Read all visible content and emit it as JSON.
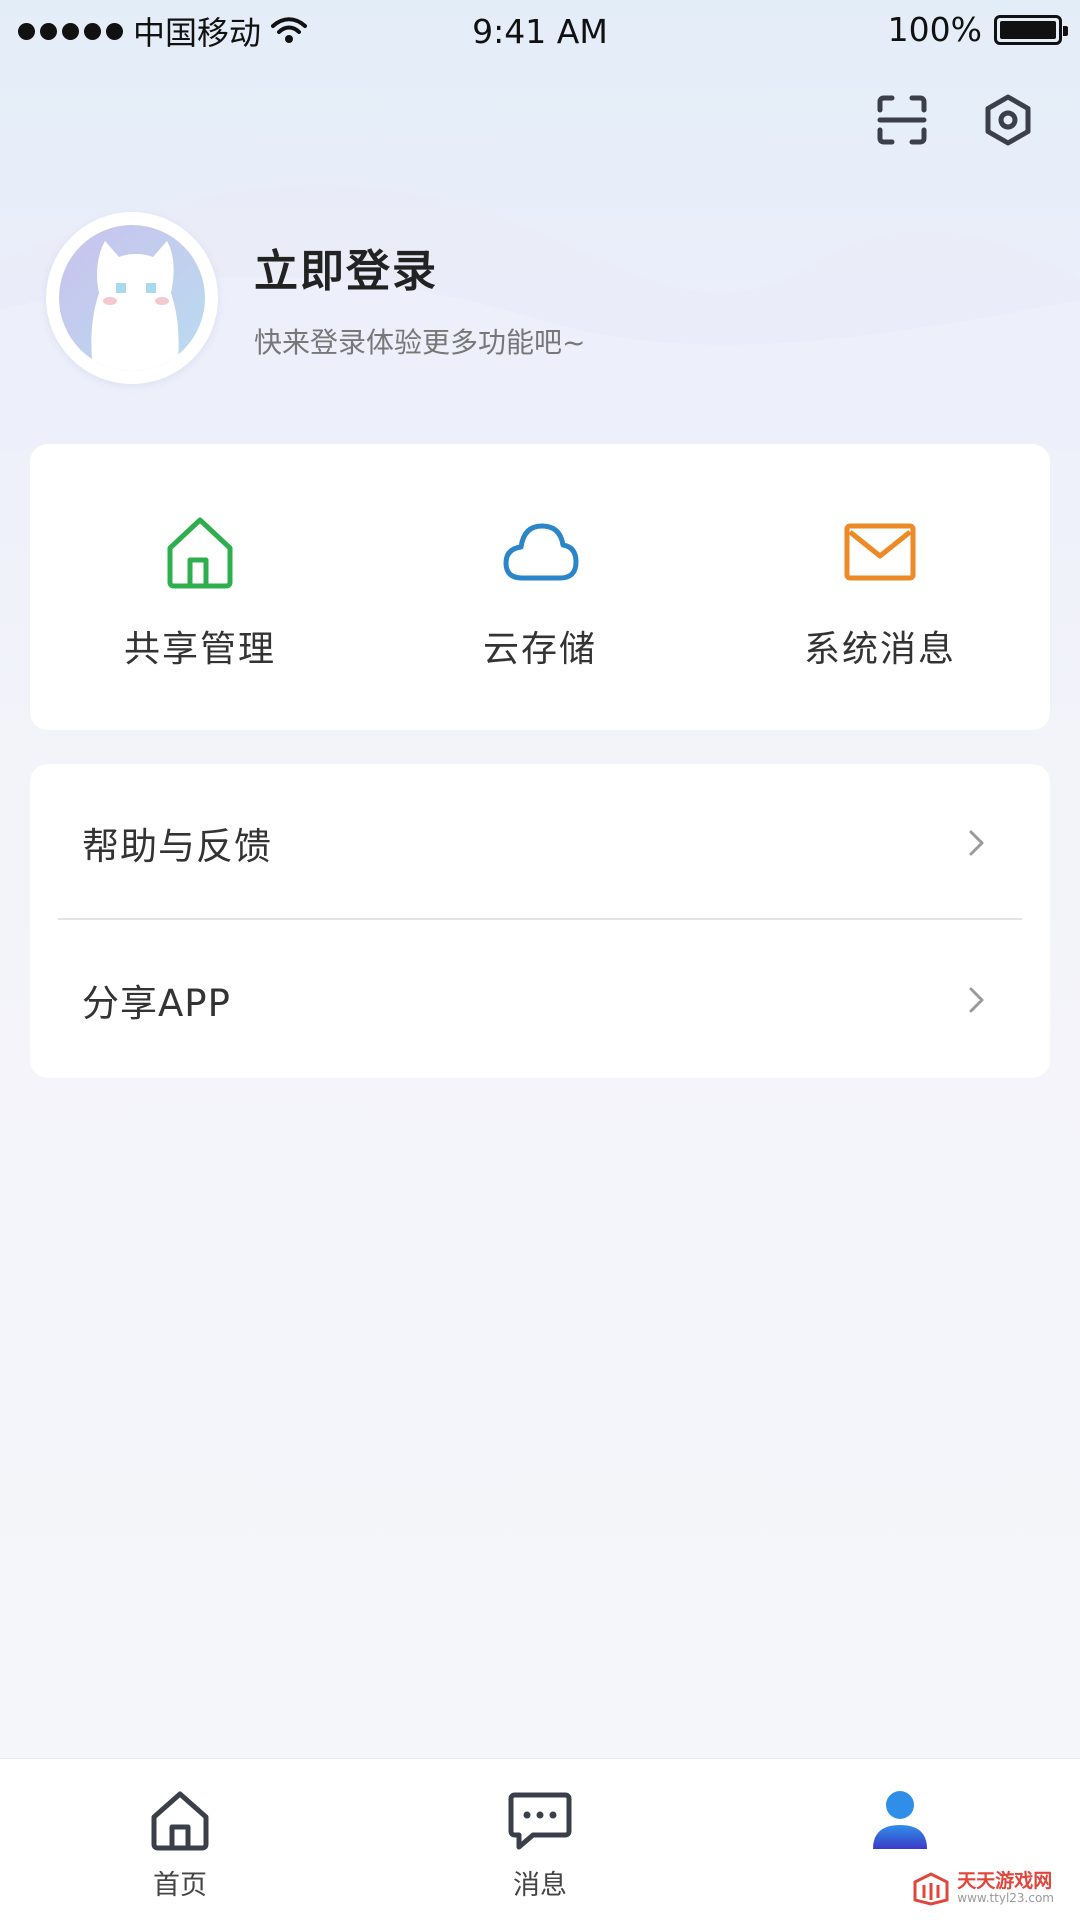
{
  "status_bar": {
    "carrier": "中国移动",
    "time": "9:41 AM",
    "battery": "100%",
    "battery_level": 1.0
  },
  "header": {
    "scan_icon": "scan-icon",
    "settings_icon": "gear-icon"
  },
  "profile": {
    "title": "立即登录",
    "subtitle": "快来登录体验更多功能吧~"
  },
  "features": [
    {
      "label": "共享管理",
      "icon": "home-icon",
      "color": "#2fae4e"
    },
    {
      "label": "云存储",
      "icon": "cloud-icon",
      "color": "#2a86c8"
    },
    {
      "label": "系统消息",
      "icon": "mail-icon",
      "color": "#ec8a25"
    }
  ],
  "menu": [
    {
      "label": "帮助与反馈"
    },
    {
      "label": "分享APP"
    }
  ],
  "tab_bar": [
    {
      "label": "首页",
      "icon": "home-icon"
    },
    {
      "label": "消息",
      "icon": "message-icon"
    },
    {
      "label": "",
      "icon": "user-icon",
      "active": true
    }
  ],
  "watermark": {
    "name": "天天游戏网",
    "url": "www.ttyl23.com"
  },
  "colors": {
    "accent": "#3d3fd0",
    "green": "#2fae4e",
    "blue": "#2a86c8",
    "orange": "#ec8a25"
  }
}
